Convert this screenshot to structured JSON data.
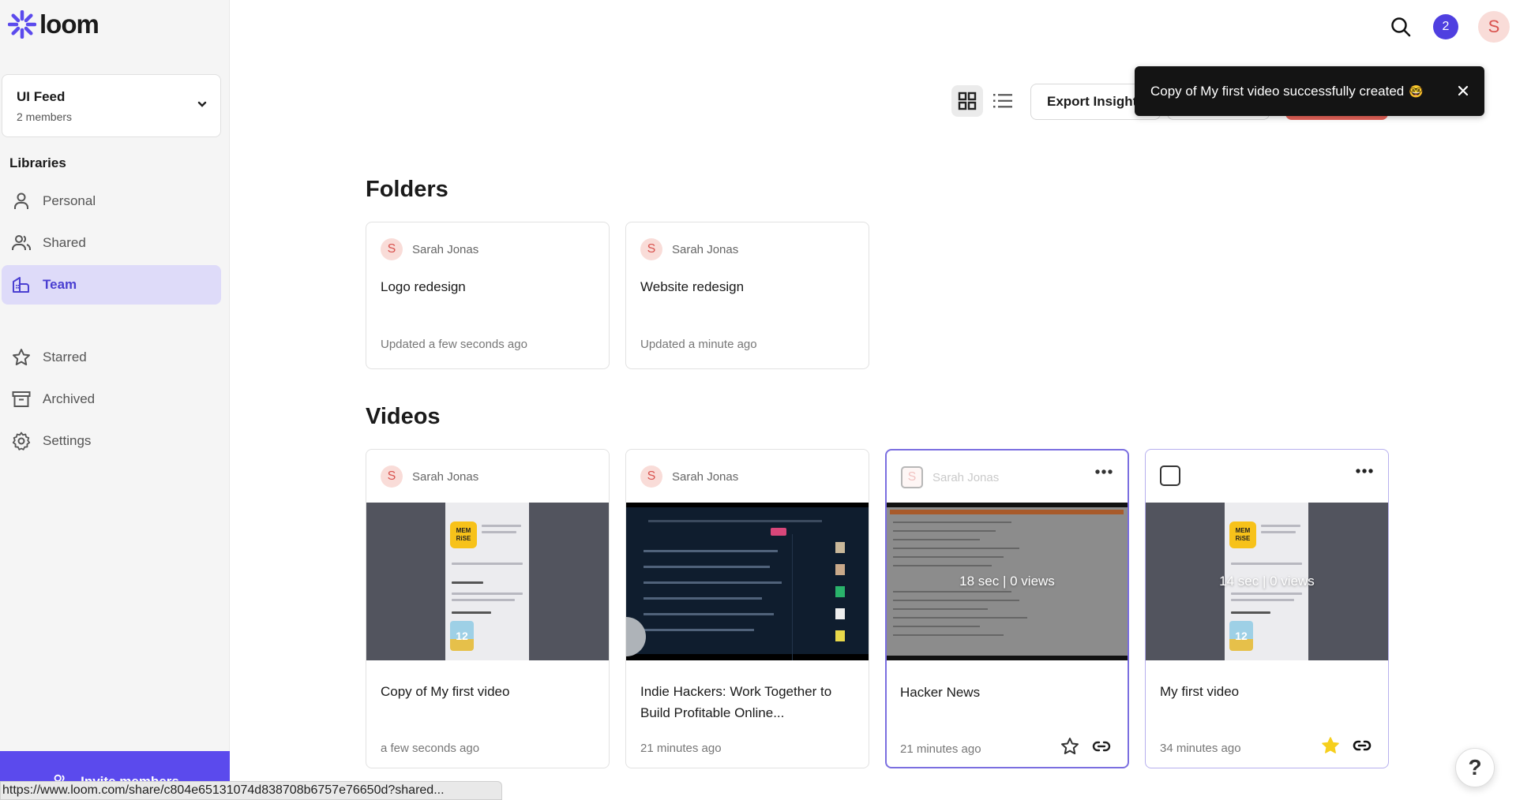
{
  "app": {
    "logo_text": "loom",
    "brand_color": "#5b4aed"
  },
  "sidebar": {
    "workspace": {
      "name": "UI Feed",
      "members": "2 members"
    },
    "libraries_label": "Libraries",
    "items": [
      {
        "label": "Personal",
        "icon": "person-icon",
        "active": false
      },
      {
        "label": "Shared",
        "icon": "people-icon",
        "active": false
      },
      {
        "label": "Team",
        "icon": "building-icon",
        "active": true
      },
      {
        "label": "Starred",
        "icon": "star-icon",
        "active": false
      },
      {
        "label": "Archived",
        "icon": "archive-box-icon",
        "active": false
      },
      {
        "label": "Settings",
        "icon": "gear-icon",
        "active": false
      }
    ],
    "invite_label": "Invite members"
  },
  "topbar": {
    "notification_count": "2",
    "user_initial": "S"
  },
  "toolbar": {
    "export_label": "Export Insights"
  },
  "toast": {
    "message": "Copy of My first video successfully created",
    "emoji": "🤓"
  },
  "folders": {
    "title": "Folders",
    "items": [
      {
        "owner": "Sarah Jonas",
        "owner_initial": "S",
        "name": "Logo redesign",
        "updated": "Updated a few seconds ago"
      },
      {
        "owner": "Sarah Jonas",
        "owner_initial": "S",
        "name": "Website redesign",
        "updated": "Updated a minute ago"
      }
    ]
  },
  "videos": {
    "title": "Videos",
    "items": [
      {
        "owner": "Sarah Jonas",
        "owner_initial": "S",
        "title": "Copy of My first video",
        "time": "a few seconds ago",
        "starred": false
      },
      {
        "owner": "Sarah Jonas",
        "owner_initial": "S",
        "title": "Indie Hackers: Work Together to Build Profitable Online...",
        "time": "21 minutes ago",
        "starred": false
      },
      {
        "owner": "Sarah Jonas",
        "owner_initial": "S",
        "title": "Hacker News",
        "time": "21 minutes ago",
        "stats": "18 sec | 0 views",
        "starred": false
      },
      {
        "owner": "",
        "owner_initial": "",
        "title": "My first video",
        "time": "34 minutes ago",
        "stats": "14 sec | 0 views",
        "starred": true
      }
    ]
  },
  "status_bar": {
    "url": "https://www.loom.com/share/c804e65131074d838708b6757e76650d?shared..."
  },
  "help_label": "?"
}
